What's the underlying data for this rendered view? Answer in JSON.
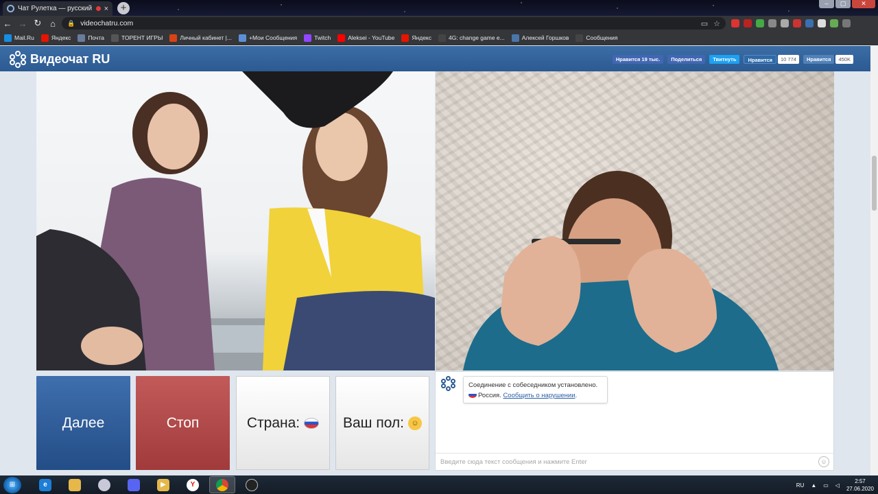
{
  "browser": {
    "tab_title": "Чат Рулетка — русский ви...",
    "tab_close": "×",
    "new_tab": "+",
    "url": "videochatru.com",
    "bookmarks": [
      {
        "label": "Mail.Ru",
        "color": "#168de2"
      },
      {
        "label": "Яндекс",
        "color": "#e61400"
      },
      {
        "label": "Почта",
        "color": "#6a7b9c"
      },
      {
        "label": "ТОРЕНТ ИГРЫ",
        "color": "#555555"
      },
      {
        "label": "Личный кабинет |...",
        "color": "#d84315"
      },
      {
        "label": "+Мои Сообщения",
        "color": "#5d8fd6"
      },
      {
        "label": "Twitch",
        "color": "#9146ff"
      },
      {
        "label": "Aleksei - YouTube",
        "color": "#ff0000"
      },
      {
        "label": "Яндекс",
        "color": "#e61400"
      },
      {
        "label": "4G: change game e...",
        "color": "#444444"
      },
      {
        "label": "Алексей Горшков",
        "color": "#4a76a8"
      },
      {
        "label": "Сообщения",
        "color": "#444444"
      }
    ]
  },
  "site": {
    "logo_text": "Видеочат RU",
    "social": {
      "fb_like": "Нравится 19 тыс.",
      "fb_share": "Поделиться",
      "twitter": "Твитнуть",
      "ok_like": "Нравится",
      "ok_count": "10 774",
      "vk_like": "Нравится",
      "vk_count": "450K"
    }
  },
  "controls": {
    "next_label": "Далее",
    "stop_label": "Стоп",
    "country_label": "Страна:",
    "gender_label": "Ваш пол:"
  },
  "chat": {
    "system_message_line1": "Соединение с собеседником установлено.",
    "country": "Россия.",
    "report_link": "Сообщить о нарушении",
    "report_suffix": ".",
    "input_placeholder": "Введите сюда текст сообщения и нажмите Enter"
  },
  "taskbar": {
    "language": "RU",
    "time": "2:57",
    "date": "27.06.2020"
  }
}
